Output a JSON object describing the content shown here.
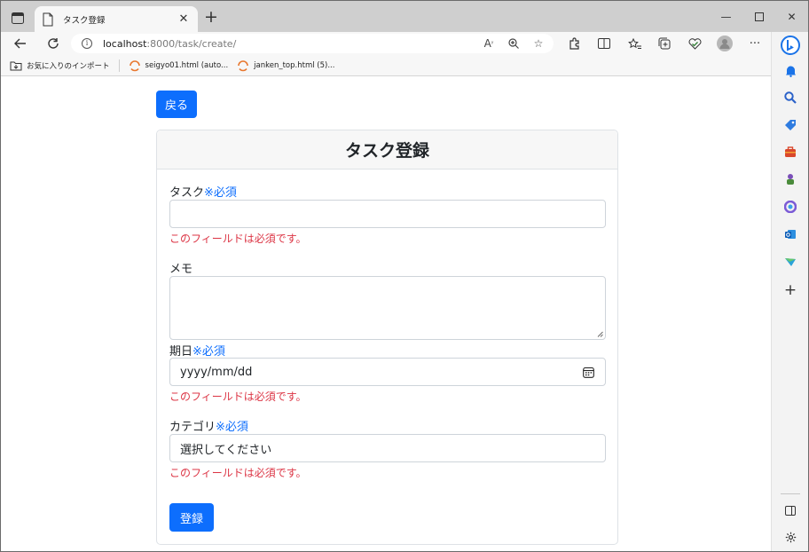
{
  "browser": {
    "tab_title": "タスク登録",
    "url_host": "localhost",
    "url_rest": ":8000/task/create/",
    "bookmarks": [
      {
        "label": "お気に入りのインポート"
      },
      {
        "label": "seigyo01.html (auto..."
      },
      {
        "label": "janken_top.html (5)..."
      }
    ]
  },
  "page": {
    "back_label": "戻る",
    "card_title": "タスク登録",
    "fields": {
      "task_label": "タスク",
      "task_required": "※必須",
      "task_error": "このフィールドは必須です。",
      "memo_label": "メモ",
      "due_label": "期日",
      "due_required": "※必須",
      "due_placeholder": "yyyy/mm/dd",
      "due_error": "このフィールドは必須です。",
      "category_label": "カテゴリ",
      "category_required": "※必須",
      "category_value": "選択してください",
      "category_error": "このフィールドは必須です。"
    },
    "submit_label": "登録"
  },
  "colors": {
    "primary": "#0d6efd",
    "error": "#dc3545"
  }
}
